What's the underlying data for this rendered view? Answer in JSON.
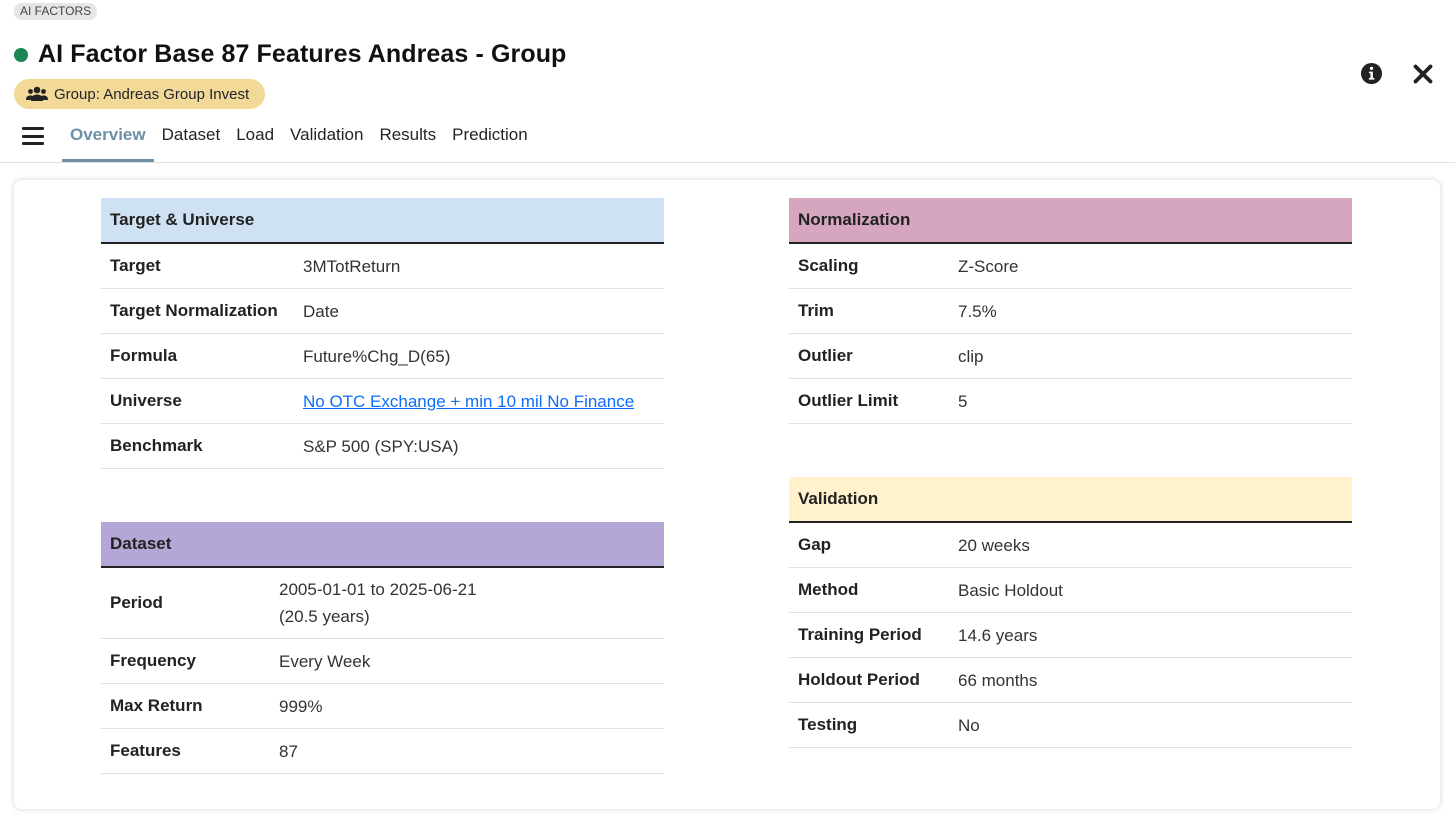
{
  "breadcrumb": "AI FACTORS",
  "title": "AI Factor Base 87 Features Andreas - Group",
  "status_color": "#198754",
  "group_badge": "Group: Andreas Group Invest",
  "icons": {
    "group": "users-icon",
    "info": "info-circle-icon",
    "close": "close-icon",
    "menu": "hamburger-menu-icon"
  },
  "tabs": [
    "Overview",
    "Dataset",
    "Load",
    "Validation",
    "Results",
    "Prediction"
  ],
  "active_tab": "Overview",
  "target_universe": {
    "heading": "Target & Universe",
    "color": "#cfe2f3",
    "rows": [
      {
        "label": "Target",
        "value": "3MTotReturn"
      },
      {
        "label": "Target Normalization",
        "value": "Date"
      },
      {
        "label": "Formula",
        "value": "Future%Chg_D(65)"
      },
      {
        "label": "Universe",
        "value": "No OTC Exchange + min 10 mil No Finance"
      },
      {
        "label": "Benchmark",
        "value": "S&P 500 (SPY:USA)"
      }
    ]
  },
  "dataset": {
    "heading": "Dataset",
    "color": "#b4a7d6",
    "rows": [
      {
        "label": "Period",
        "value": "2005-01-01 to 2025-06-21",
        "value2": "(20.5 years)"
      },
      {
        "label": "Frequency",
        "value": "Every Week"
      },
      {
        "label": "Max Return",
        "value": "999%"
      },
      {
        "label": "Features",
        "value": "87"
      }
    ]
  },
  "normalization": {
    "heading": "Normalization",
    "color": "#d5a6bd",
    "rows": [
      {
        "label": "Scaling",
        "value": "Z-Score"
      },
      {
        "label": "Trim",
        "value": "7.5%"
      },
      {
        "label": "Outlier",
        "value": "clip"
      },
      {
        "label": "Outlier Limit",
        "value": "5"
      }
    ]
  },
  "validation": {
    "heading": "Validation",
    "color": "#fff2cc",
    "rows": [
      {
        "label": "Gap",
        "value": "20 weeks"
      },
      {
        "label": "Method",
        "value": "Basic Holdout"
      },
      {
        "label": "Training Period",
        "value": "14.6 years"
      },
      {
        "label": "Holdout Period",
        "value": "66 months"
      },
      {
        "label": "Testing",
        "value": "No"
      }
    ]
  }
}
